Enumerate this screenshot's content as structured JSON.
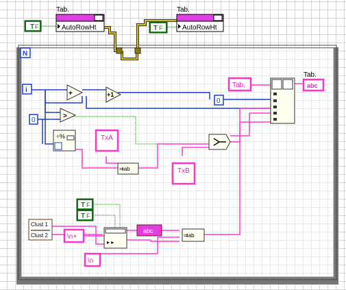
{
  "property_nodes": {
    "left": {
      "class": "Tab.",
      "property": "AutoRowHt"
    },
    "right": {
      "class": "Tab.",
      "property": "AutoRowHt"
    }
  },
  "bool_constants": {
    "left_top": "T",
    "right_top": "T",
    "bottom_1": "T",
    "bottom_2": "T"
  },
  "loop": {
    "count_terminal": "N",
    "iteration_terminal": "i"
  },
  "constants": {
    "zero_left": "0",
    "zero_right": "0",
    "tab_string": "Tab.",
    "txa": "TxA",
    "txb": "TxB",
    "newline_plus": "\\n+",
    "newline": "\\n",
    "abc": "abc"
  },
  "cluster": {
    "items": [
      "Clust 1",
      "Clust 2"
    ]
  },
  "output": {
    "label": "Tab.",
    "terminal": "abc"
  },
  "colors": {
    "string_wire": "#ff00ff",
    "numeric_wire": "#1a3fcf",
    "boolean_wire": "#107010",
    "refnum_wire": "#b8a400",
    "node_fill": "#fffff0"
  }
}
